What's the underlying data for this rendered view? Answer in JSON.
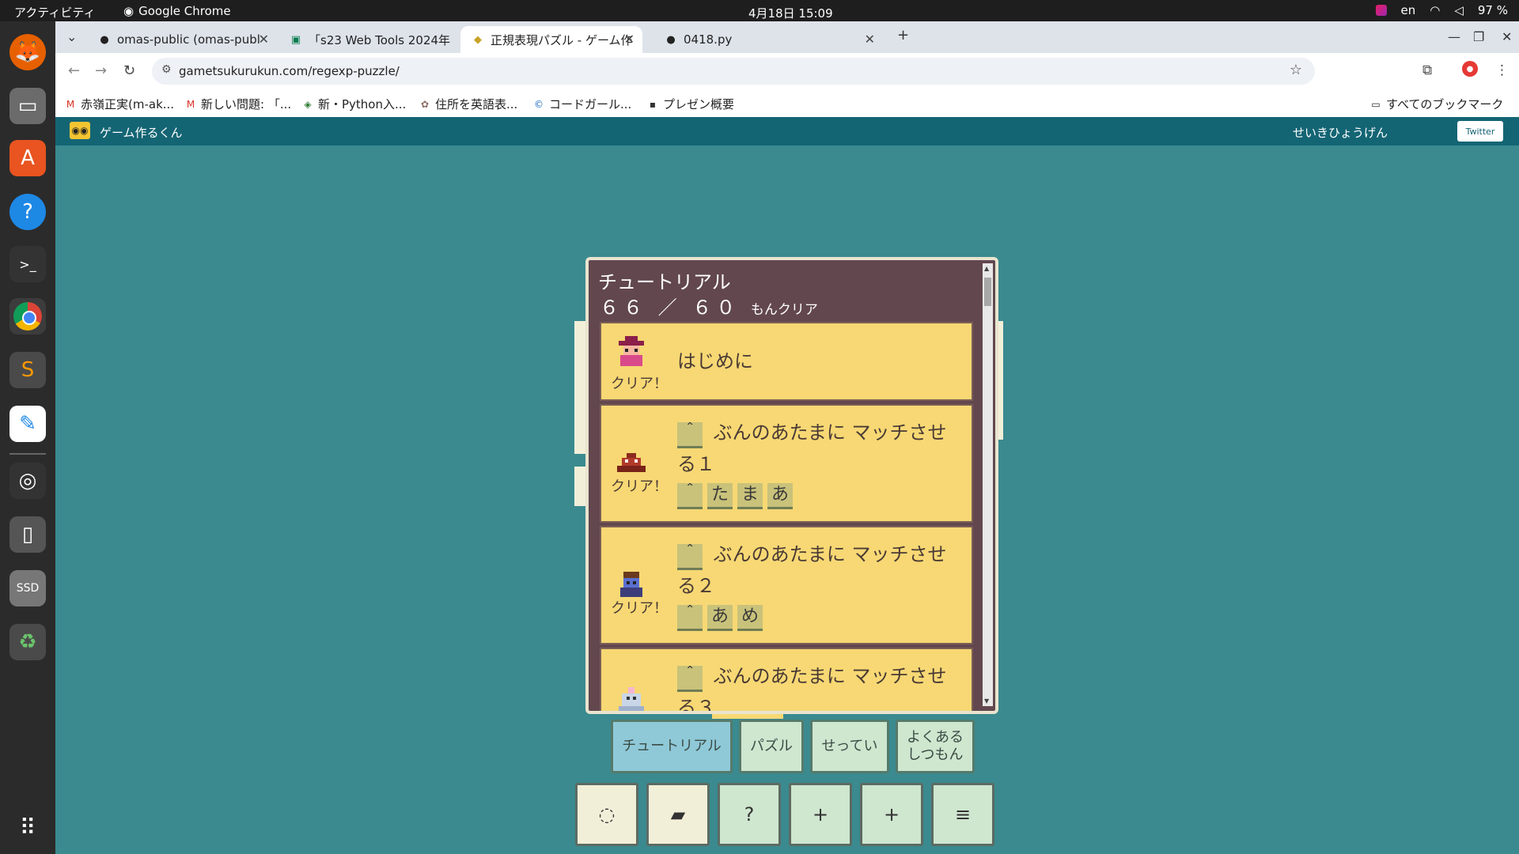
{
  "os": {
    "activities": "アクティビティ",
    "app_name": "Google Chrome",
    "clock": "4月18日  15:09",
    "lang": "en",
    "battery": "97 %"
  },
  "dock": [
    "firefox-icon",
    "files-icon",
    "app-center-icon",
    "help-icon",
    "terminal-icon",
    "chrome-icon",
    "sublime-icon",
    "text-editor-icon",
    "screenshot-icon",
    "drive-icon",
    "ssd-icon",
    "trash-icon",
    "app-grid-icon"
  ],
  "tabs": [
    {
      "label": "omas-public (omas-publ",
      "icon": "github-icon"
    },
    {
      "label": "「s23 Web Tools 2024年",
      "icon": "classroom-icon"
    },
    {
      "label": "正規表現パズル - ゲーム作",
      "icon": "site-icon"
    },
    {
      "label": "0418.py",
      "icon": "github-icon"
    }
  ],
  "url": "gametsukurukun.com/regexp-puzzle/",
  "bookmarks": [
    {
      "label": "赤嶺正実(m-ak...",
      "icon": "gmail-icon"
    },
    {
      "label": "新しい問題: 「...",
      "icon": "gmail-icon"
    },
    {
      "label": "新・Python入...",
      "icon": "python-icon"
    },
    {
      "label": "住所を英語表...",
      "icon": "globe-icon"
    },
    {
      "label": "コードガール...",
      "icon": "code-icon"
    },
    {
      "label": "プレゼン概要",
      "icon": "slides-icon"
    }
  ],
  "all_bookmarks": "すべてのブックマーク",
  "site": {
    "name": "ゲーム作るくん",
    "right_link": "せいきひょうげん",
    "twitter": "Twitter"
  },
  "modal": {
    "title": "チュートリアル",
    "count": "６６ ／ ６０",
    "count_suffix": "もんクリア",
    "cards": [
      {
        "clear": "クリア！",
        "text": "はじめに",
        "tokens": []
      },
      {
        "clear": "クリア！",
        "text": "ぶんのあたまに マッチさせる１",
        "lead": "＾",
        "tokens": [
          "＾",
          "た",
          "ま",
          "あ"
        ]
      },
      {
        "clear": "クリア！",
        "text": "ぶんのあたまに マッチさせる２",
        "lead": "＾",
        "tokens": [
          "＾",
          "あ",
          "め"
        ]
      },
      {
        "clear": "",
        "text": "ぶんのあたまに マッチさせる３",
        "lead": "＾",
        "tokens": []
      }
    ]
  },
  "menu": {
    "tutorial": "チュートリアル",
    "puzzle": "パズル",
    "settings": "せってい",
    "faq": "よくある\nしつもん"
  },
  "icon_buttons": [
    "spinner-icon",
    "lock-icon",
    "?",
    "+",
    "+",
    "≡"
  ],
  "colors": {
    "page_bg": "#3a8a8f",
    "header_bg": "#146574",
    "modal_bg": "#62474f",
    "card_bg": "#f7d874",
    "button_bg": "#cfe6cf",
    "button_selected": "#8fc9d8"
  }
}
